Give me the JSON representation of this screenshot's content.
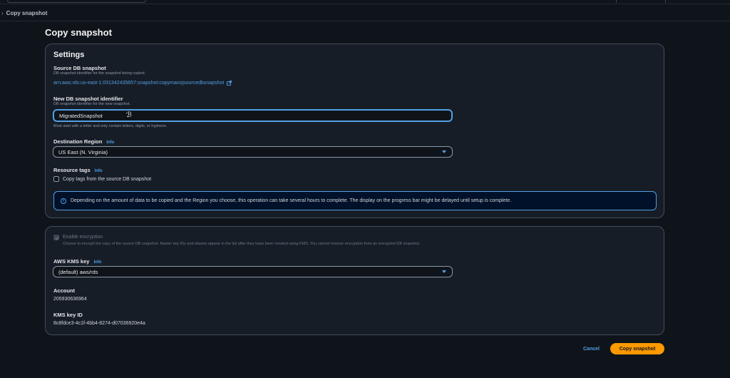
{
  "breadcrumb": {
    "current": "Copy snapshot"
  },
  "page": {
    "title": "Copy snapshot"
  },
  "settings": {
    "heading": "Settings",
    "source": {
      "label": "Source DB snapshot",
      "description": "DB snapshot identifier for the snapshot being copied.",
      "arn": "arn:aws:rds:us-east-1:031342435657:snapshot:copymanojsourcedbsnapshot"
    },
    "new_identifier": {
      "label": "New DB snapshot identifier",
      "description": "DB snapshot identifier for the new snapshot.",
      "value": "MigratedSnapshot",
      "hint": "Must start with a letter and only contain letters, digits, or hyphens."
    },
    "region": {
      "label": "Destination Region",
      "info": "Info",
      "selected": "US East (N. Virginia)"
    },
    "tags": {
      "label": "Resource tags",
      "info": "Info",
      "checkbox_label": "Copy tags from the source DB snapshot",
      "checked": false
    },
    "alert": {
      "icon": "info-circle-icon",
      "text": "Depending on the amount of data to be copied and the Region you choose, this operation can take several hours to complete. The display on the progress bar might be delayed until setup is complete."
    }
  },
  "encryption": {
    "enable_label": "Enable encryption",
    "enable_checked": true,
    "enable_disabled": true,
    "enable_description": "Choose to encrypt the copy of the source DB snapshot. Master key IDs and aliases appear in the list after they have been created using KMS. You cannot remove encryption from an encrypted DB snapshot.",
    "kms": {
      "label": "AWS KMS key",
      "info": "Info",
      "selected": "(default) aws/rds"
    },
    "account": {
      "label": "Account",
      "value": "205930636964"
    },
    "kms_key_id": {
      "label": "KMS key ID",
      "value": "8c8fdce3-4c1f-4bb4-8274-d07036920e4a"
    }
  },
  "actions": {
    "cancel": "Cancel",
    "submit": "Copy snapshot"
  },
  "colors": {
    "background": "#0f141a",
    "panel": "#161d26",
    "accent_link": "#539fe5",
    "primary_button": "#ff9900"
  }
}
